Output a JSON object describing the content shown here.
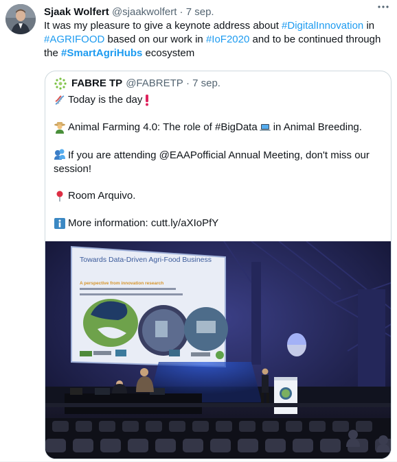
{
  "tweet": {
    "author_name": "Sjaak Wolfert",
    "handle": "@sjaakwolfert",
    "separator": "·",
    "date": "7 sep.",
    "text": {
      "p1": "It was my pleasure to give a keynote address about ",
      "h1": "#DigitalInnovation",
      "p2": " in ",
      "h2": "#AGRIFOOD",
      "p3": " based on our work in ",
      "h3": "#IoF2020",
      "p4": " and to be continued through the ",
      "h4": "#SmartAgriHubs",
      "p5": " ecosystem"
    }
  },
  "quote": {
    "author_name": "FABRE TP",
    "handle": "@FABRETP",
    "separator": "·",
    "date": "7 sep.",
    "lines": {
      "l1": "Today is the day",
      "l2": "Animal Farming 4.0: The role of #BigData",
      "l2b": " in Animal Breeding.",
      "l3": "If you are attending @EAAPofficial Annual Meeting, don't miss our session!",
      "l4": "Room Arquivo.",
      "l5": "More information: cutt.ly/aXIoPfY"
    },
    "media": {
      "slide_title": "Towards Data-Driven Agri-Food Business",
      "slide_subtitle": "A perspective from innovation research"
    }
  },
  "icons": [
    "more-icon",
    "dna-icon",
    "exclamation-icon",
    "farmer-icon",
    "laptop-icon",
    "speaking-head-icon",
    "round-pushpin-icon",
    "information-icon"
  ],
  "colors": {
    "link": "#1d9bf0",
    "text": "#0f1419",
    "muted": "#536471",
    "border": "#cfd9de"
  }
}
